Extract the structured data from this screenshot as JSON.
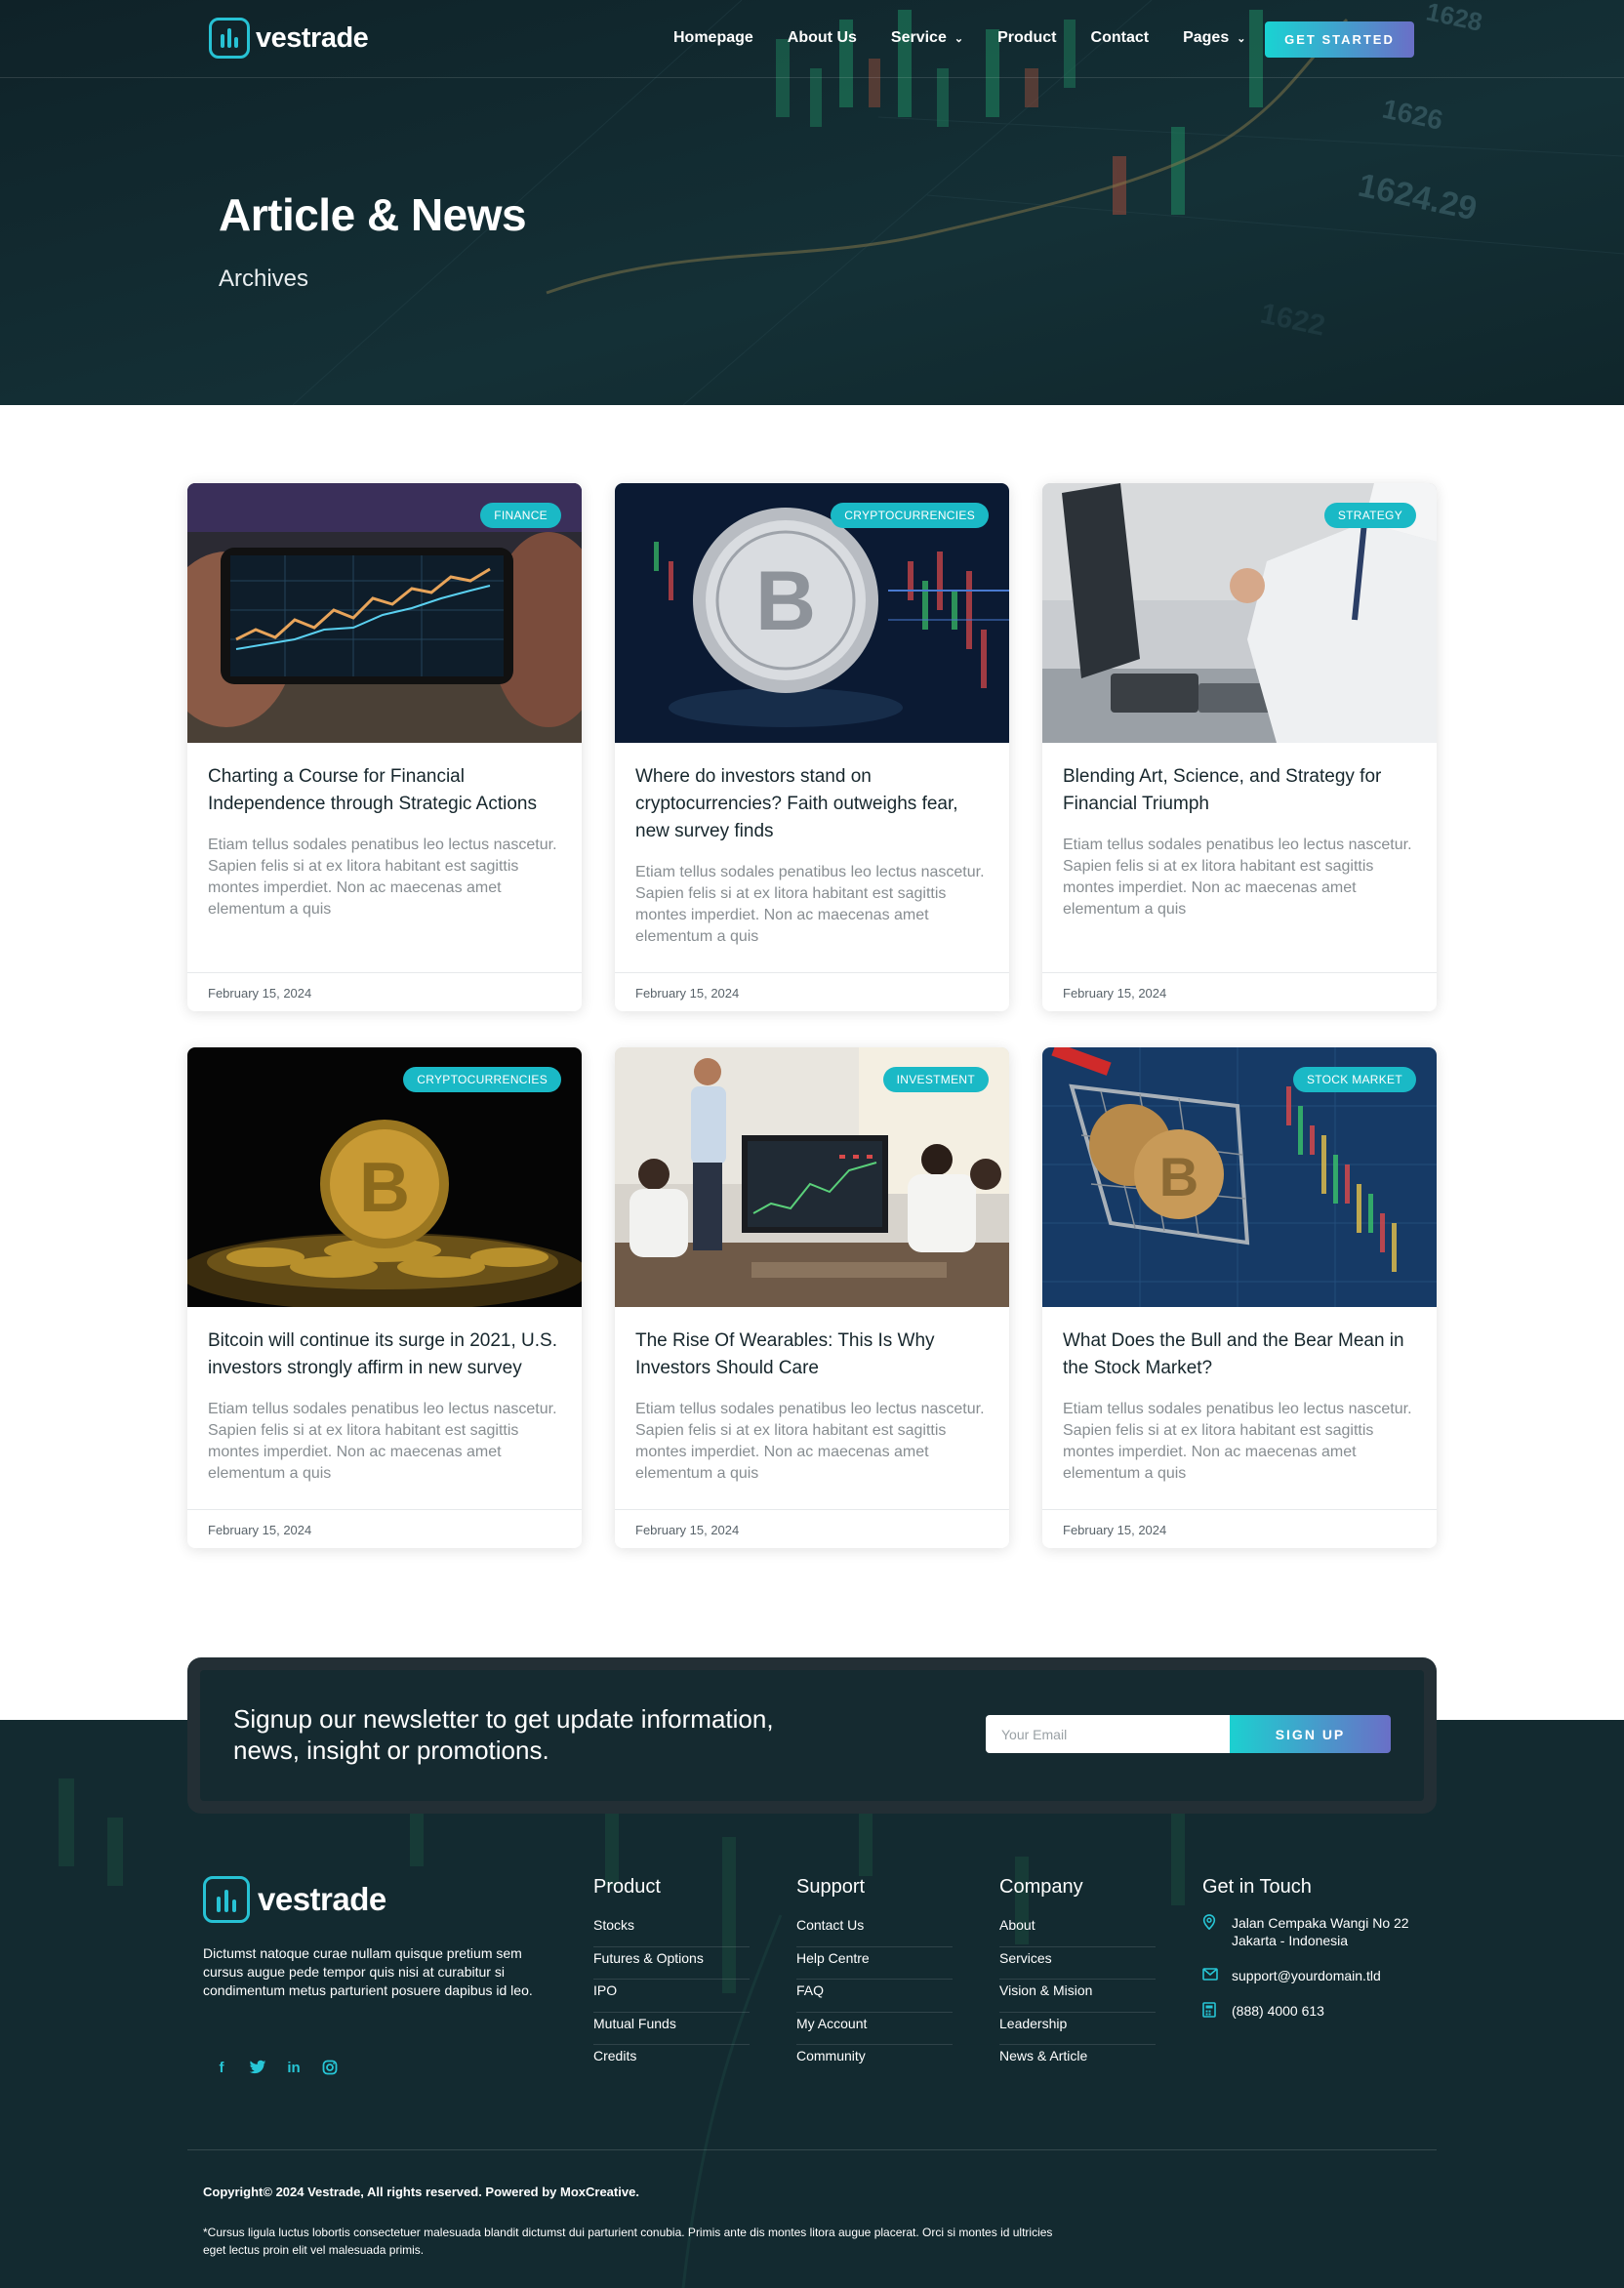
{
  "brand": {
    "name": "vestrade"
  },
  "nav": {
    "items": [
      {
        "label": "Homepage",
        "has_dropdown": false
      },
      {
        "label": "About Us",
        "has_dropdown": false
      },
      {
        "label": "Service",
        "has_dropdown": true
      },
      {
        "label": "Product",
        "has_dropdown": false
      },
      {
        "label": "Contact",
        "has_dropdown": false
      },
      {
        "label": "Pages",
        "has_dropdown": true
      }
    ],
    "cta_label": "GET STARTED"
  },
  "hero": {
    "title": "Article & News",
    "subtitle": "Archives"
  },
  "articles": [
    {
      "category": "FINANCE",
      "title": "Charting a Course for Financial Independence through Strategic Actions",
      "excerpt": "Etiam tellus sodales penatibus leo lectus nascetur. Sapien felis si at ex litora habitant est sagittis montes imperdiet. Non ac maecenas amet elementum a quis",
      "date": "February 15, 2024",
      "image": "phone-stock-chart"
    },
    {
      "category": "CRYPTOCURRENCIES",
      "title": "Where do investors stand on cryptocurrencies? Faith outweighs fear, new survey finds",
      "excerpt": "Etiam tellus sodales penatibus leo lectus nascetur. Sapien felis si at ex litora habitant est sagittis montes imperdiet. Non ac maecenas amet elementum a quis",
      "date": "February 15, 2024",
      "image": "silver-bitcoin"
    },
    {
      "category": "STRATEGY",
      "title": "Blending Art, Science, and Strategy for Financial Triumph",
      "excerpt": "Etiam tellus sodales penatibus leo lectus nascetur. Sapien felis si at ex litora habitant est sagittis montes imperdiet. Non ac maecenas amet elementum a quis",
      "date": "February 15, 2024",
      "image": "businessman-desk"
    },
    {
      "category": "CRYPTOCURRENCIES",
      "title": "Bitcoin will continue its surge in 2021, U.S. investors strongly affirm in new survey",
      "excerpt": "Etiam tellus sodales penatibus leo lectus nascetur. Sapien felis si at ex litora habitant est sagittis montes imperdiet. Non ac maecenas amet elementum a quis",
      "date": "February 15, 2024",
      "image": "gold-bitcoin"
    },
    {
      "category": "INVESTMENT",
      "title": "The Rise Of Wearables: This Is Why Investors Should Care",
      "excerpt": "Etiam tellus sodales penatibus leo lectus nascetur. Sapien felis si at ex litora habitant est sagittis montes imperdiet. Non ac maecenas amet elementum a quis",
      "date": "February 15, 2024",
      "image": "meeting-presentation"
    },
    {
      "category": "STOCK MARKET",
      "title": "What Does the Bull and the Bear Mean in the Stock Market?",
      "excerpt": "Etiam tellus sodales penatibus leo lectus nascetur. Sapien felis si at ex litora habitant est sagittis montes imperdiet. Non ac maecenas amet elementum a quis",
      "date": "February 15, 2024",
      "image": "coins-shopping-cart"
    }
  ],
  "newsletter": {
    "text": "Signup our newsletter to get update information, news, insight or promotions.",
    "placeholder": "Your Email",
    "button": "SIGN UP"
  },
  "footer": {
    "description": "Dictumst natoque curae nullam quisque pretium sem cursus augue pede tempor quis nisi at curabitur si condimentum metus parturient posuere dapibus id leo.",
    "socials": [
      "facebook-icon",
      "twitter-icon",
      "linkedin-icon",
      "instagram-icon"
    ],
    "columns": [
      {
        "title": "Product",
        "links": [
          "Stocks",
          "Futures & Options",
          "IPO",
          "Mutual Funds",
          "Credits"
        ]
      },
      {
        "title": "Support",
        "links": [
          "Contact Us",
          "Help Centre",
          "FAQ",
          "My Account",
          "Community"
        ]
      },
      {
        "title": "Company",
        "links": [
          "About",
          "Services",
          "Vision & Mision",
          "Leadership",
          "News & Article"
        ]
      }
    ],
    "contact": {
      "title": "Get in Touch",
      "address": "Jalan Cempaka Wangi No 22 Jakarta - Indonesia",
      "email": "support@yourdomain.tld",
      "phone": "(888) 4000 613"
    },
    "copyright": "Copyright© 2024 Vestrade, All rights reserved. Powered by MoxCreative.",
    "disclaimer": "*Cursus ligula luctus lobortis consectetuer malesuada blandit dictumst dui parturient conubia. Primis ante dis montes litora augue placerat. Orci si montes id ultricies eget lectus proin elit vel malesuada primis."
  },
  "colors": {
    "accent": "#1ab9c6",
    "dark": "#11262c",
    "gradient_end": "#6a6fc7"
  }
}
